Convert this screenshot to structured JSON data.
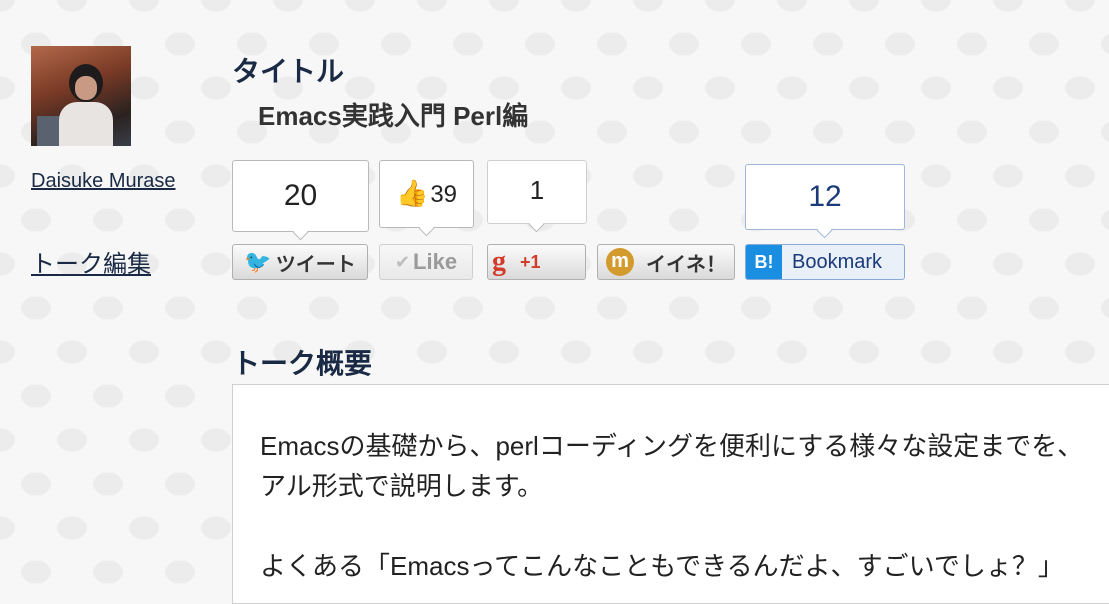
{
  "user": {
    "name": "Daisuke Murase",
    "edit_link": "トーク編集"
  },
  "talk": {
    "title_heading": "タイトル",
    "title": "Emacs実践入門 Perl編"
  },
  "social": {
    "twitter": {
      "count": "20",
      "button_label": "ツイート"
    },
    "facebook": {
      "count": "39",
      "button_label": "Like"
    },
    "google_plus": {
      "count": "1",
      "button_label": "+1"
    },
    "mixi": {
      "button_label": "イイネ！"
    },
    "hatena": {
      "count": "12",
      "button_icon": "B!",
      "button_label": "Bookmark"
    }
  },
  "summary": {
    "heading": "トーク概要",
    "lines": [
      "Emacsの基礎から、perlコーディングを便利にする様々な設定までを、",
      "アル形式で説明します。",
      "よくある「Emacsってこんなこともできるんだよ、すごいでしょ？」"
    ]
  }
}
